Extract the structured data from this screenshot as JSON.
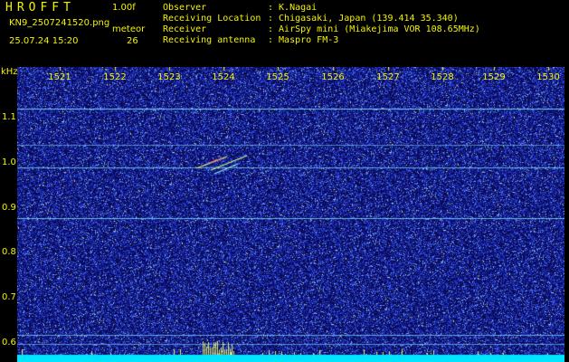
{
  "app": {
    "title": "HROFFT",
    "version": "1.00f",
    "filename": "KN9_2507241520.png",
    "mode": "meteor",
    "datetime": "25.07.24 15:20",
    "count": "26"
  },
  "station_info": [
    {
      "label": "Observer",
      "value": ": K.Nagai"
    },
    {
      "label": "Receiving Location",
      "value": ": Chigasaki, Japan (139.414 35.340)"
    },
    {
      "label": "Receiver",
      "value": ": AirSpy mini (Miakejima VOR 108.65MHz)"
    },
    {
      "label": "Receiving antenna",
      "value": ": Maspro FM-3"
    }
  ],
  "axes": {
    "unit": "kHz",
    "frequency_labels": [
      "1521",
      "1522",
      "1523",
      "1524",
      "1525",
      "1526",
      "1527",
      "1528",
      "1529",
      "1530"
    ],
    "khz_labels": [
      "1.1",
      "1.0",
      "0.9",
      "0.8",
      "0.7",
      "0.6"
    ]
  },
  "colors": {
    "text": "#f3f300",
    "background": "#000000",
    "spectrogram_base": "#0a0a55",
    "noise": "#2a4bd8",
    "line": "#7fe0ff",
    "floor": "#00e5ff"
  }
}
